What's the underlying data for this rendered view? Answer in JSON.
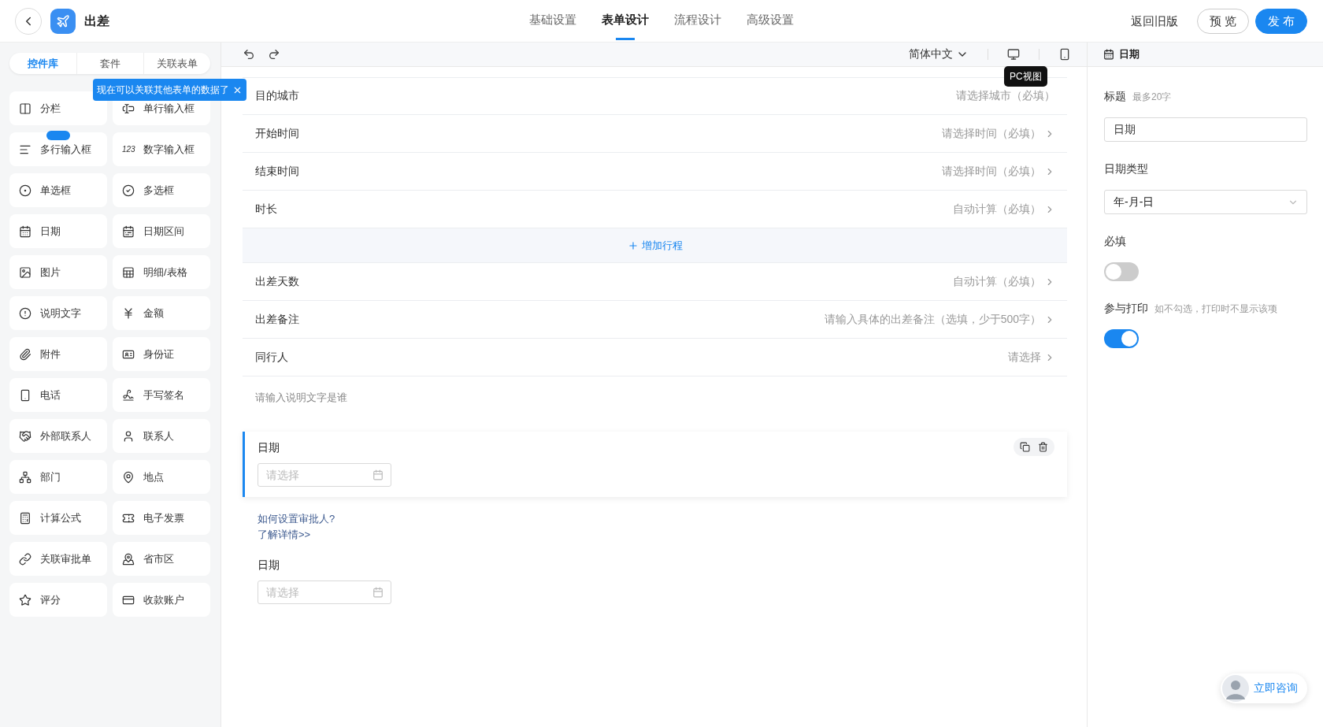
{
  "header": {
    "title": "出差",
    "tabs": [
      {
        "label": "基础设置",
        "selected": false
      },
      {
        "label": "表单设计",
        "selected": true
      },
      {
        "label": "流程设计",
        "selected": false
      },
      {
        "label": "高级设置",
        "selected": false
      }
    ],
    "actions": [
      {
        "kind": "link",
        "label": "返回旧版"
      },
      {
        "kind": "outline",
        "label": "预 览"
      },
      {
        "kind": "primary",
        "label": "发 布"
      }
    ]
  },
  "library": {
    "tabs": [
      {
        "label": "控件库",
        "selected": true
      },
      {
        "label": "套件",
        "selected": false
      },
      {
        "label": "关联表单",
        "selected": false
      }
    ],
    "tooltip": "现在可以关联其他表单的数据了",
    "items": [
      {
        "label": "分栏"
      },
      {
        "label": "单行输入框"
      },
      {
        "label": "多行输入框"
      },
      {
        "label": "数字输入框",
        "icon_text": "123"
      },
      {
        "label": "单选框"
      },
      {
        "label": "多选框"
      },
      {
        "label": "日期"
      },
      {
        "label": "日期区间"
      },
      {
        "label": "图片"
      },
      {
        "label": "明细/表格"
      },
      {
        "label": "说明文字"
      },
      {
        "label": "金额"
      },
      {
        "label": "附件"
      },
      {
        "label": "身份证"
      },
      {
        "label": "电话"
      },
      {
        "label": "手写签名"
      },
      {
        "label": "外部联系人"
      },
      {
        "label": "联系人"
      },
      {
        "label": "部门"
      },
      {
        "label": "地点"
      },
      {
        "label": "计算公式"
      },
      {
        "label": "电子发票"
      },
      {
        "label": "关联审批单"
      },
      {
        "label": "省市区"
      },
      {
        "label": "评分"
      },
      {
        "label": "收款账户"
      }
    ]
  },
  "toolbar": {
    "language": "简体中文",
    "tooltip": "PC视图"
  },
  "form": {
    "rows": [
      {
        "kind": "field",
        "label": "目的城市",
        "hint": "请选择城市（必填）",
        "arrow": false
      },
      {
        "kind": "field",
        "label": "开始时间",
        "hint": "请选择时间（必填）",
        "arrow": true
      },
      {
        "kind": "field",
        "label": "结束时间",
        "hint": "请选择时间（必填）",
        "arrow": true
      },
      {
        "kind": "field",
        "label": "时长",
        "hint": "自动计算（必填）",
        "arrow": true
      },
      {
        "kind": "add",
        "label": "增加行程"
      },
      {
        "kind": "field",
        "label": "出差天数",
        "hint": "自动计算（必填）",
        "arrow": true
      },
      {
        "kind": "field",
        "label": "出差备注",
        "hint": "请输入具体的出差备注（选填，少于500字）",
        "arrow": true
      },
      {
        "kind": "field",
        "label": "同行人",
        "hint": "请选择",
        "arrow": true
      },
      {
        "kind": "note",
        "hint": "请输入说明文字是谁"
      }
    ],
    "blocks": [
      {
        "kind": "date",
        "label": "日期",
        "placeholder": "请选择",
        "selected": true
      },
      {
        "kind": "help",
        "question": "如何设置审批人?",
        "link": "了解详情>>"
      },
      {
        "kind": "date",
        "label": "日期",
        "placeholder": "请选择",
        "selected": false
      }
    ]
  },
  "panel": {
    "title": "日期",
    "fields": [
      {
        "kind": "text",
        "label": "标题",
        "hint": "最多20字",
        "value": "日期"
      },
      {
        "kind": "select",
        "label": "日期类型",
        "value": "年-月-日"
      },
      {
        "kind": "toggle",
        "label": "必填",
        "on": false
      },
      {
        "kind": "toggle",
        "label": "参与打印",
        "hint": "如不勾选，打印时不显示该项",
        "on": true
      }
    ]
  },
  "consult": {
    "label": "立即咨询"
  }
}
